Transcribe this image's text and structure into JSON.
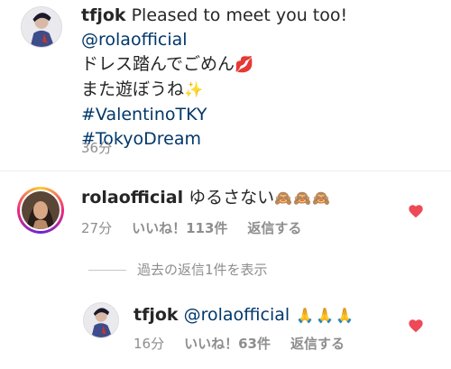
{
  "post": {
    "username": "tfjok",
    "line1_text": " Pleased to meet you too!",
    "mention": "@rolaofficial",
    "line3_text": "ドレス踏んでごめん",
    "line3_emoji": "💋",
    "line4_text": "また遊ぼうね",
    "line4_emoji": "✨",
    "hashtag1": "#ValentinoTKY",
    "hashtag2": "#TokyoDream",
    "time": "36分"
  },
  "comment": {
    "username": "rolaofficial",
    "text": " ゆるさない",
    "emoji": "🙈🙈🙈",
    "time": "27分",
    "likes": "いいね！113件",
    "reply": "返信する"
  },
  "view_replies": "過去の返信1件を表示",
  "reply_comment": {
    "username": "tfjok",
    "mention": " @rolaofficial",
    "emoji": " 🙏🙏🙏",
    "time": "16分",
    "likes": "いいね！63件",
    "reply": "返信する"
  },
  "colors": {
    "like_heart": "#ed4956",
    "link": "#00376b",
    "meta": "#8e8e8e"
  }
}
